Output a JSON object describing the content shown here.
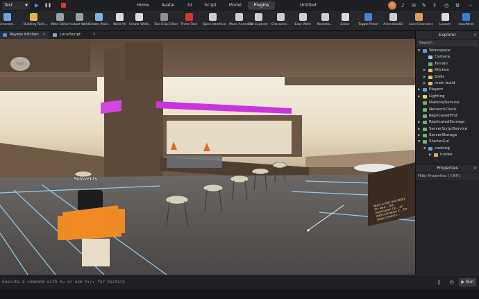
{
  "topbar": {
    "place": "Test",
    "controls": [
      "▶",
      "❚❚",
      "■"
    ],
    "tabs": [
      {
        "label": "Home",
        "active": false
      },
      {
        "label": "Avatar",
        "active": false
      },
      {
        "label": "UI",
        "active": false
      },
      {
        "label": "Script",
        "active": false
      },
      {
        "label": "Model",
        "active": false
      },
      {
        "label": "Plugins",
        "active": true
      }
    ],
    "title": "Untitled"
  },
  "ribbon": {
    "tools": [
      {
        "label": "Generate...",
        "icon": "generate-icon",
        "color": "#6fa3e8"
      },
      {
        "label": "Building Tools...",
        "icon": "building-tools-icon",
        "color": "#e0b84a"
      },
      {
        "label": "Weld Editor",
        "icon": "weld-icon",
        "color": "#9aa0a8"
      },
      {
        "label": "Instant Weld",
        "icon": "weld-icon",
        "color": "#9aa0a8"
      },
      {
        "label": "Create Plain...",
        "icon": "plain-icon",
        "color": "#7fb3e6"
      },
      {
        "label": "Weld All",
        "icon": "weld-icon",
        "color": "#dcdcdc"
      },
      {
        "label": "Create Weld...",
        "icon": "weld-icon",
        "color": "#dcdcdc"
      },
      {
        "label": "Tool Grip Editor",
        "icon": "grip-icon",
        "color": "#8f8f8f"
      },
      {
        "label": "Three Text",
        "icon": "three-text-icon",
        "color": "#d8352a"
      },
      {
        "label": "Open interface",
        "icon": "chevron-up-icon",
        "color": "#cfcfcf"
      },
      {
        "label": "Moon Animator",
        "icon": "moon-icon",
        "color": "#cfcfcf"
      },
      {
        "label": "File Explorer",
        "icon": "folder-icon",
        "color": "#cfcfcf"
      },
      {
        "label": "Character...",
        "icon": "character-icon",
        "color": "#cfcfcf"
      },
      {
        "label": "Easy Weld",
        "icon": "weld-icon",
        "color": "#cfcfcf"
      },
      {
        "label": "Realistic...",
        "icon": "realistic-icon",
        "color": "#cfcfcf"
      },
      {
        "label": "Editor",
        "icon": "cloud-icon",
        "color": "#dcdcdc"
      },
      {
        "label": "Toggle Picker",
        "icon": "picker-icon",
        "color": "#4a7fd8"
      },
      {
        "label": "AnimationID",
        "icon": "animation-icon",
        "color": "#cfcfcf"
      },
      {
        "label": "Load Character",
        "icon": "load-character-icon",
        "color": "#e09a5a"
      },
      {
        "label": "Launch",
        "icon": "launch-icon",
        "color": "#dcdcdc"
      },
      {
        "label": "easyWeld",
        "icon": "easyweld-icon",
        "color": "#3c7fd8"
      }
    ]
  },
  "doc_tabs": [
    "Reysos Kitchen",
    "LocalScript"
  ],
  "viewport": {
    "player_name": "Solavents",
    "sign_text": "Want a job? and apply for Awa... the Application Ce... an Administration C... for steps toward r..."
  },
  "explorer": {
    "title": "Explorer",
    "search_placeholder": "Search",
    "items": [
      {
        "label": "Workspace",
        "depth": 0,
        "expanded": true,
        "icon": "workspace-icon",
        "color": "#5b9be0"
      },
      {
        "label": "Camera",
        "depth": 1,
        "expanded": null,
        "icon": "camera-icon",
        "color": "#9ec2e8"
      },
      {
        "label": "Terrain",
        "depth": 1,
        "expanded": null,
        "icon": "terrain-icon",
        "color": "#67b56b"
      },
      {
        "label": "Kitchen",
        "depth": 1,
        "expanded": false,
        "icon": "folder-icon",
        "color": "#e3c05c"
      },
      {
        "label": "Grills",
        "depth": 1,
        "expanded": false,
        "icon": "folder-icon",
        "color": "#e3c05c"
      },
      {
        "label": "main build",
        "depth": 1,
        "expanded": false,
        "icon": "folder-icon",
        "color": "#e3c05c"
      },
      {
        "label": "Players",
        "depth": 0,
        "expanded": false,
        "icon": "players-icon",
        "color": "#5b9be0"
      },
      {
        "label": "Lighting",
        "depth": 0,
        "expanded": false,
        "icon": "lighting-icon",
        "color": "#e8d25c"
      },
      {
        "label": "MaterialService",
        "depth": 0,
        "expanded": null,
        "icon": "material-icon",
        "color": "#6fb36f"
      },
      {
        "label": "NetworkClient",
        "depth": 0,
        "expanded": null,
        "icon": "network-icon",
        "color": "#6fb36f"
      },
      {
        "label": "ReplicatedFirst",
        "depth": 0,
        "expanded": null,
        "icon": "replicated-icon",
        "color": "#6fb36f"
      },
      {
        "label": "ReplicatedStorage",
        "depth": 0,
        "expanded": false,
        "icon": "storage-icon",
        "color": "#6fb36f"
      },
      {
        "label": "ServerScriptService",
        "depth": 0,
        "expanded": false,
        "icon": "server-script-icon",
        "color": "#6fb36f"
      },
      {
        "label": "ServerStorage",
        "depth": 0,
        "expanded": false,
        "icon": "server-storage-icon",
        "color": "#6fb36f"
      },
      {
        "label": "StarterGui",
        "depth": 0,
        "expanded": true,
        "icon": "starter-gui-icon",
        "color": "#6fb36f"
      },
      {
        "label": "cooking",
        "depth": 1,
        "expanded": true,
        "icon": "gui-icon",
        "color": "#5ba0d8"
      },
      {
        "label": "holder",
        "depth": 2,
        "expanded": false,
        "icon": "frame-icon",
        "color": "#d8b05a"
      }
    ]
  },
  "properties": {
    "title": "Properties",
    "filter_placeholder": "Filter Properties (⇧⌘P)"
  },
  "command_bar": {
    "placeholder": "Execute a command with ⌘↵ or use ⌘↑/↓ for history",
    "run_label": "Run"
  }
}
